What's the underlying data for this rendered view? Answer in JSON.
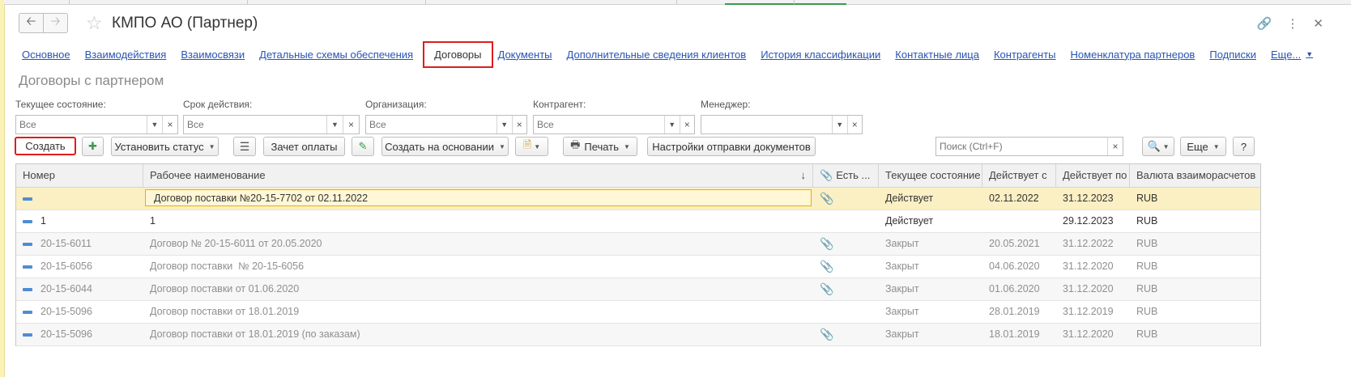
{
  "window": {
    "title": "КМПО АО (Партнер)"
  },
  "sections": [
    {
      "label": "Основное",
      "active": false
    },
    {
      "label": "Взаимодействия",
      "active": false
    },
    {
      "label": "Взаимосвязи",
      "active": false
    },
    {
      "label": "Детальные схемы обеспечения",
      "active": false
    },
    {
      "label": "Договоры",
      "active": true
    },
    {
      "label": "Документы",
      "active": false
    },
    {
      "label": "Дополнительные сведения клиентов",
      "active": false
    },
    {
      "label": "История классификации",
      "active": false
    },
    {
      "label": "Контактные лица",
      "active": false
    },
    {
      "label": "Контрагенты",
      "active": false
    },
    {
      "label": "Номенклатура партнеров",
      "active": false
    },
    {
      "label": "Подписки",
      "active": false
    },
    {
      "label": "Еще...",
      "active": false
    }
  ],
  "form_title": "Договоры с партнером",
  "filters": {
    "state": {
      "label": "Текущее состояние:",
      "placeholder": "Все"
    },
    "term": {
      "label": "Срок действия:",
      "placeholder": "Все"
    },
    "org": {
      "label": "Организация:",
      "placeholder": "Все"
    },
    "counterparty": {
      "label": "Контрагент:",
      "placeholder": "Все"
    },
    "manager": {
      "label": "Менеджер:",
      "placeholder": ""
    }
  },
  "toolbar": {
    "create": "Создать",
    "set_status": "Установить статус",
    "offset_payment": "Зачет оплаты",
    "create_based_on": "Создать на основании",
    "print": "Печать",
    "send_settings": "Настройки отправки документов",
    "search_placeholder": "Поиск (Ctrl+F)",
    "more": "Еще",
    "help": "?"
  },
  "table": {
    "columns": {
      "number": "Номер",
      "name": "Рабочее наименование",
      "files": "Есть ...",
      "state": "Текущее состояние",
      "from": "Действует с",
      "to": "Действует по",
      "currency": "Валюта взаиморасчетов"
    },
    "rows": [
      {
        "number": "",
        "name": "Договор поставки №20-15-7702 от 02.11.2022",
        "has_files": true,
        "state": "Действует",
        "from": "02.11.2022",
        "to": "31.12.2023",
        "currency": "RUB"
      },
      {
        "number": "1",
        "name": "1",
        "has_files": false,
        "state": "Действует",
        "from": "",
        "to": "29.12.2023",
        "currency": "RUB"
      },
      {
        "number": "20-15-6011",
        "name": "Договор № 20-15-6011 от 20.05.2020",
        "has_files": true,
        "state": "Закрыт",
        "from": "20.05.2021",
        "to": "31.12.2022",
        "currency": "RUB"
      },
      {
        "number": "20-15-6056",
        "name": "Договор поставки  № 20-15-6056",
        "has_files": true,
        "state": "Закрыт",
        "from": "04.06.2020",
        "to": "31.12.2020",
        "currency": "RUB"
      },
      {
        "number": "20-15-6044",
        "name": "Договор поставки от 01.06.2020",
        "has_files": true,
        "state": "Закрыт",
        "from": "01.06.2020",
        "to": "31.12.2020",
        "currency": "RUB"
      },
      {
        "number": "20-15-5096",
        "name": "Договор поставки от 18.01.2019",
        "has_files": false,
        "state": "Закрыт",
        "from": "28.01.2019",
        "to": "31.12.2019",
        "currency": "RUB"
      },
      {
        "number": "20-15-5096",
        "name": "Договор поставки от 18.01.2019 (по заказам)",
        "has_files": true,
        "state": "Закрыт",
        "from": "18.01.2019",
        "to": "31.12.2020",
        "currency": "RUB"
      }
    ]
  },
  "colors": {
    "link": "#2754b3",
    "highlight_border": "#e01c1c",
    "selected_row": "#fbefc4",
    "row_icon": "#4f8dd1"
  }
}
